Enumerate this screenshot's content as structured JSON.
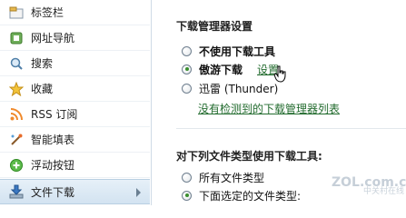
{
  "sidebar": {
    "items": [
      {
        "label": "标签栏",
        "icon": "tab-bar-icon"
      },
      {
        "label": "网址导航",
        "icon": "url-nav-icon"
      },
      {
        "label": "搜索",
        "icon": "search-icon"
      },
      {
        "label": "收藏",
        "icon": "star-icon"
      },
      {
        "label": "RSS 订阅",
        "icon": "rss-icon"
      },
      {
        "label": "智能填表",
        "icon": "form-fill-icon"
      },
      {
        "label": "浮动按钮",
        "icon": "float-button-icon"
      },
      {
        "label": "文件下载",
        "icon": "download-icon"
      }
    ]
  },
  "download_manager": {
    "title": "下载管理器设置",
    "options": [
      {
        "label": "不使用下载工具",
        "checked": false
      },
      {
        "label": "傲游下载",
        "checked": true
      },
      {
        "label": "迅雷 (Thunder)",
        "checked": false
      }
    ],
    "settings_link": "设置",
    "not_detected_link": "没有检测到的下载管理器列表"
  },
  "file_types": {
    "title": "对下列文件类型使用下载工具:",
    "options": [
      {
        "label": "所有文件类型",
        "checked": false
      },
      {
        "label": "下面选定的文件类型:",
        "checked": true
      }
    ]
  },
  "watermark": {
    "line1": "ZOL.com.cn",
    "line2": "中关村在线"
  },
  "colors": {
    "link": "#226b2e",
    "radio_checked": "#3a8f2f",
    "active_item": "#d3e3f1"
  }
}
